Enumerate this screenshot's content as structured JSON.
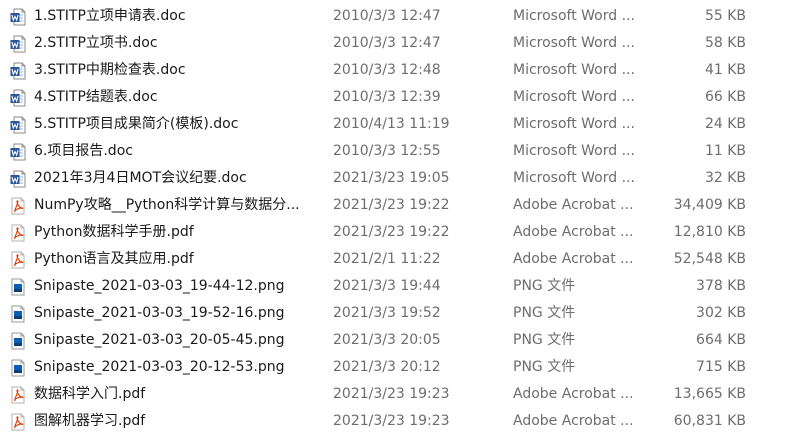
{
  "colors": {
    "word_blue": "#2b579a",
    "pdf_red": "#d83b01",
    "png_blue": "#0a5fb4",
    "text": "#1a1a1a",
    "meta": "#6d6d6d"
  },
  "files": [
    {
      "name": "1.STITP立项申请表.doc",
      "modified": "2010/3/3 12:47",
      "type": "Microsoft Word ...",
      "size": "55 KB",
      "icon": "word-doc-icon"
    },
    {
      "name": "2.STITP立项书.doc",
      "modified": "2010/3/3 12:47",
      "type": "Microsoft Word ...",
      "size": "58 KB",
      "icon": "word-doc-icon"
    },
    {
      "name": "3.STITP中期检查表.doc",
      "modified": "2010/3/3 12:48",
      "type": "Microsoft Word ...",
      "size": "41 KB",
      "icon": "word-doc-icon"
    },
    {
      "name": "4.STITP结题表.doc",
      "modified": "2010/3/3 12:39",
      "type": "Microsoft Word ...",
      "size": "66 KB",
      "icon": "word-doc-icon"
    },
    {
      "name": "5.STITP项目成果简介(模板).doc",
      "modified": "2010/4/13 11:19",
      "type": "Microsoft Word ...",
      "size": "24 KB",
      "icon": "word-doc-icon"
    },
    {
      "name": "6.项目报告.doc",
      "modified": "2010/3/3 12:55",
      "type": "Microsoft Word ...",
      "size": "11 KB",
      "icon": "word-doc-icon"
    },
    {
      "name": "2021年3月4日MOT会议纪要.doc",
      "modified": "2021/3/23 19:05",
      "type": "Microsoft Word ...",
      "size": "32 KB",
      "icon": "word-doc-icon"
    },
    {
      "name": "NumPy攻略__Python科学计算与数据分...",
      "modified": "2021/3/23 19:22",
      "type": "Adobe Acrobat ...",
      "size": "34,409 KB",
      "icon": "pdf-icon"
    },
    {
      "name": "Python数据科学手册.pdf",
      "modified": "2021/3/23 19:22",
      "type": "Adobe Acrobat ...",
      "size": "12,810 KB",
      "icon": "pdf-icon"
    },
    {
      "name": "Python语言及其应用.pdf",
      "modified": "2021/2/1 11:22",
      "type": "Adobe Acrobat ...",
      "size": "52,548 KB",
      "icon": "pdf-icon"
    },
    {
      "name": "Snipaste_2021-03-03_19-44-12.png",
      "modified": "2021/3/3 19:44",
      "type": "PNG 文件",
      "size": "378 KB",
      "icon": "png-image-icon"
    },
    {
      "name": "Snipaste_2021-03-03_19-52-16.png",
      "modified": "2021/3/3 19:52",
      "type": "PNG 文件",
      "size": "302 KB",
      "icon": "png-image-icon"
    },
    {
      "name": "Snipaste_2021-03-03_20-05-45.png",
      "modified": "2021/3/3 20:05",
      "type": "PNG 文件",
      "size": "664 KB",
      "icon": "png-image-icon"
    },
    {
      "name": "Snipaste_2021-03-03_20-12-53.png",
      "modified": "2021/3/3 20:12",
      "type": "PNG 文件",
      "size": "715 KB",
      "icon": "png-image-icon"
    },
    {
      "name": "数据科学入门.pdf",
      "modified": "2021/3/23 19:23",
      "type": "Adobe Acrobat ...",
      "size": "13,665 KB",
      "icon": "pdf-icon"
    },
    {
      "name": "图解机器学习.pdf",
      "modified": "2021/3/23 19:23",
      "type": "Adobe Acrobat ...",
      "size": "60,831 KB",
      "icon": "pdf-icon"
    }
  ]
}
